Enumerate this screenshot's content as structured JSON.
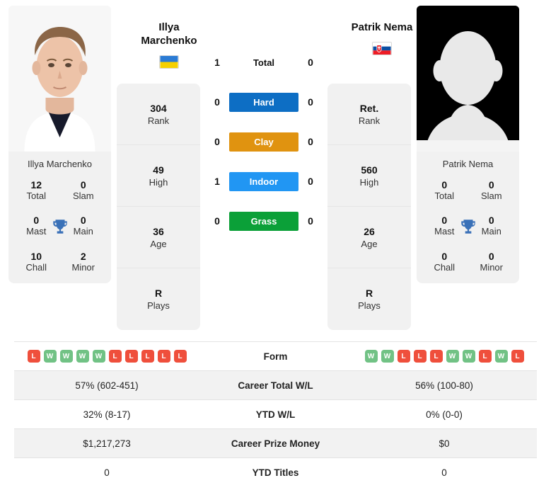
{
  "players": {
    "left": {
      "name": "Illya Marchenko",
      "display_name_line1": "Illya",
      "display_name_line2": "Marchenko",
      "country": "Ukraine",
      "flag_icon": "flag-ukraine-icon",
      "photo_icon": "player-photo-marchenko",
      "career_title": "Illya Marchenko",
      "titles": [
        {
          "value": "12",
          "label": "Total"
        },
        {
          "value": "0",
          "label": "Slam"
        },
        {
          "value": "0",
          "label": "Mast"
        },
        {
          "value": "0",
          "label": "Main"
        },
        {
          "value": "10",
          "label": "Chall"
        },
        {
          "value": "2",
          "label": "Minor"
        }
      ],
      "stack": [
        {
          "value": "304",
          "label": "Rank"
        },
        {
          "value": "49",
          "label": "High"
        },
        {
          "value": "36",
          "label": "Age"
        },
        {
          "value": "R",
          "label": "Plays"
        }
      ],
      "form": [
        "L",
        "W",
        "W",
        "W",
        "W",
        "L",
        "L",
        "L",
        "L",
        "L"
      ],
      "career_total_wl": "57% (602-451)",
      "ytd_wl": "32% (8-17)",
      "career_prize_money": "$1,217,273",
      "ytd_titles": "0"
    },
    "right": {
      "name": "Patrik Nema",
      "display_name_line1": "Patrik Nema",
      "display_name_line2": "",
      "country": "Slovakia",
      "flag_icon": "flag-slovakia-icon",
      "photo_icon": "player-photo-placeholder",
      "career_title": "Patrik Nema",
      "titles": [
        {
          "value": "0",
          "label": "Total"
        },
        {
          "value": "0",
          "label": "Slam"
        },
        {
          "value": "0",
          "label": "Mast"
        },
        {
          "value": "0",
          "label": "Main"
        },
        {
          "value": "0",
          "label": "Chall"
        },
        {
          "value": "0",
          "label": "Minor"
        }
      ],
      "stack": [
        {
          "value": "Ret.",
          "label": "Rank"
        },
        {
          "value": "560",
          "label": "High"
        },
        {
          "value": "26",
          "label": "Age"
        },
        {
          "value": "R",
          "label": "Plays"
        }
      ],
      "form": [
        "W",
        "W",
        "L",
        "L",
        "L",
        "W",
        "W",
        "L",
        "W",
        "L"
      ],
      "career_total_wl": "56% (100-80)",
      "ytd_wl": "0% (0-0)",
      "career_prize_money": "$0",
      "ytd_titles": "0"
    }
  },
  "trophy_icon": "trophy-icon",
  "trophy_color": "#3a71b8",
  "h2h": [
    {
      "label": "Total",
      "left": "1",
      "right": "0",
      "color": "transparent",
      "text_color": "#111111",
      "plain": true
    },
    {
      "label": "Hard",
      "left": "0",
      "right": "0",
      "color": "#0d6ec4",
      "text_color": "#ffffff",
      "plain": false
    },
    {
      "label": "Clay",
      "left": "0",
      "right": "0",
      "color": "#e09310",
      "text_color": "#ffffff",
      "plain": false
    },
    {
      "label": "Indoor",
      "left": "1",
      "right": "0",
      "color": "#2196f3",
      "text_color": "#ffffff",
      "plain": false
    },
    {
      "label": "Grass",
      "left": "0",
      "right": "0",
      "color": "#0ba038",
      "text_color": "#ffffff",
      "plain": false
    }
  ],
  "table": {
    "rows": [
      {
        "label": "Form",
        "type": "form",
        "left": "",
        "right": "",
        "shade": false
      },
      {
        "label": "Career Total W/L",
        "type": "text",
        "left": "57% (602-451)",
        "right": "56% (100-80)",
        "shade": true
      },
      {
        "label": "YTD W/L",
        "type": "text",
        "left": "32% (8-17)",
        "right": "0% (0-0)",
        "shade": false
      },
      {
        "label": "Career Prize Money",
        "type": "text",
        "left": "$1,217,273",
        "right": "$0",
        "shade": true
      },
      {
        "label": "YTD Titles",
        "type": "text",
        "left": "0",
        "right": "0",
        "shade": false
      }
    ]
  },
  "colors": {
    "win_badge": "#71c285",
    "loss_badge": "#ef4f3c",
    "card_bg": "#f1f1f1",
    "row_shade": "#f2f2f2"
  }
}
